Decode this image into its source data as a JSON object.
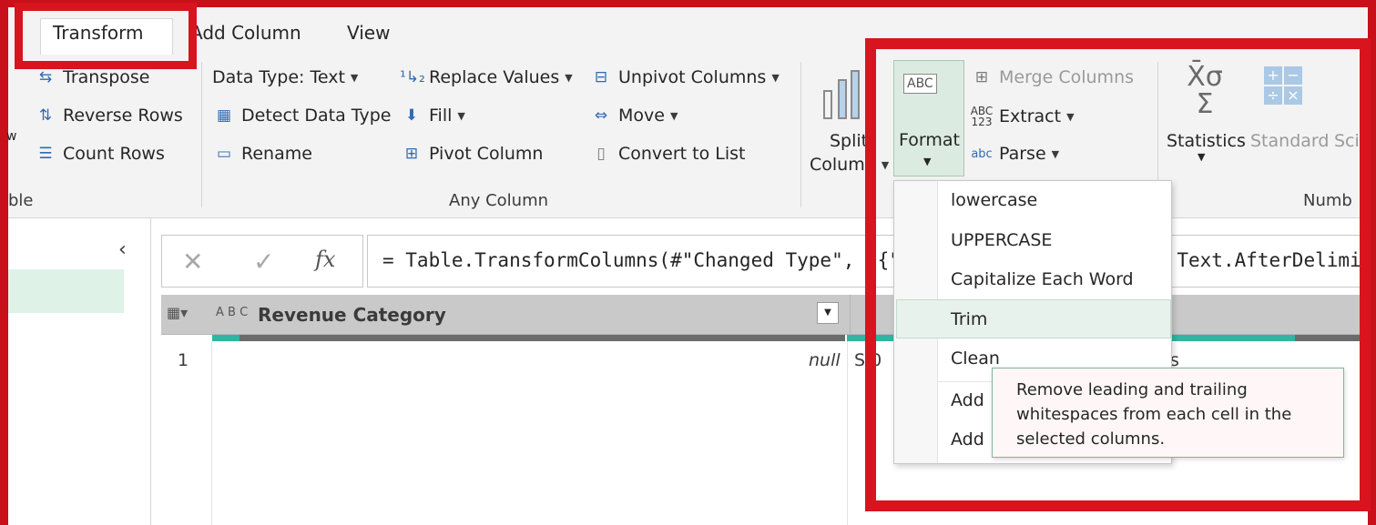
{
  "tabs": [
    {
      "label": "Transform",
      "active": true
    },
    {
      "label": "Add Column"
    },
    {
      "label": "View"
    }
  ],
  "ribbon": {
    "table_group": {
      "transpose": "Transpose",
      "reverse_rows": "Reverse Rows",
      "count_rows": "Count Rows",
      "partial_left": "w",
      "group_label": "ble"
    },
    "any_column": {
      "data_type": "Data Type: Text",
      "detect_data_type": "Detect Data Type",
      "rename": "Rename",
      "replace_values": "Replace Values",
      "fill": "Fill",
      "pivot_column": "Pivot Column",
      "unpivot_columns": "Unpivot Columns",
      "move": "Move",
      "convert_to_list": "Convert to List",
      "group_label": "Any Column"
    },
    "text_column": {
      "split_line1": "Split",
      "split_line2": "Column",
      "format": "Format",
      "merge_columns": "Merge Columns",
      "extract": "Extract",
      "parse": "Parse"
    },
    "number_column": {
      "statistics": "Statistics",
      "standard": "Standard",
      "scientific_partial": "Sci",
      "group_label_partial": "Numb"
    }
  },
  "formula_bar": {
    "cancel": "✕",
    "confirm": "✓",
    "fx": "fx",
    "formula": "= Table.TransformColumns(#\"Changed Type\", {{\"Revenue Category\", each Text.AfterDelimiter(_, \" \"), type text}})"
  },
  "grid": {
    "column_header": "Revenue Category",
    "col_type": "A B C",
    "row_number": "1",
    "null_value": "null",
    "cell_partial": "S 0",
    "cell_partial2": "s"
  },
  "format_menu": {
    "items": [
      "lowercase",
      "UPPERCASE",
      "Capitalize Each Word",
      "Trim",
      "Clean",
      "Add",
      "Add"
    ],
    "hovered": "Trim",
    "tooltip": "Remove leading and trailing whitespaces from each cell in the selected columns."
  },
  "colors": {
    "highlight": "#d8141e",
    "accent": "#2eb6a2",
    "ribbon_bg": "#f3f3f3"
  }
}
